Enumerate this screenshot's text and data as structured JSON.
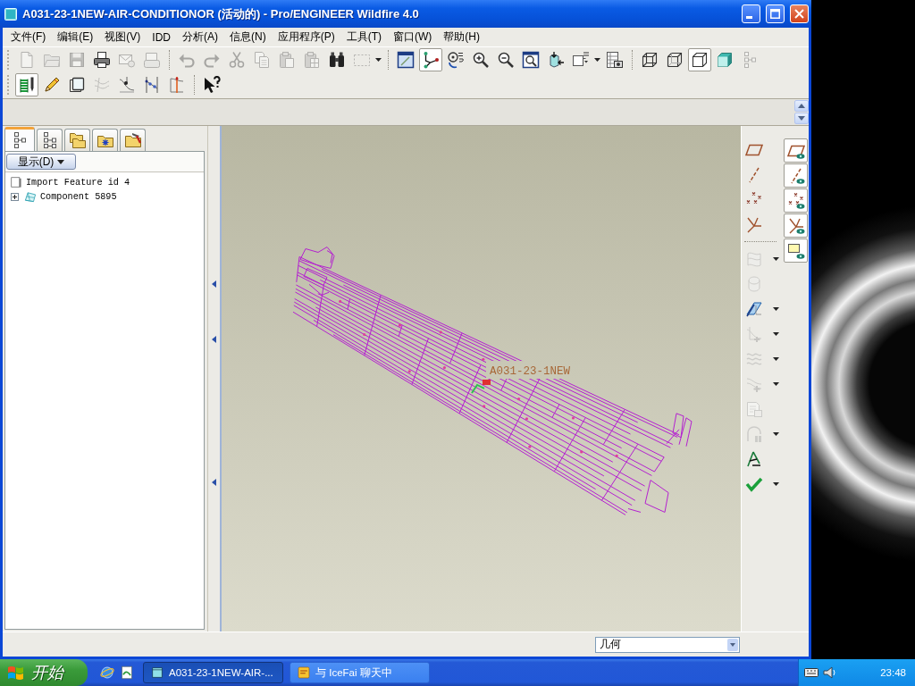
{
  "window": {
    "title": "A031-23-1NEW-AIR-CONDITIONOR (活动的) - Pro/ENGINEER Wildfire 4.0"
  },
  "menu_bar": [
    "文件(F)",
    "编辑(E)",
    "视图(V)",
    "IDD",
    "分析(A)",
    "信息(N)",
    "应用程序(P)",
    "工具(T)",
    "窗口(W)",
    "帮助(H)"
  ],
  "toolbar_rows": [
    {
      "groups": [
        {
          "buttons": [
            {
              "kind": "page",
              "disabled": true,
              "pressed": false,
              "menu": false
            },
            {
              "kind": "folder",
              "disabled": true,
              "pressed": false,
              "menu": false
            },
            {
              "kind": "floppy",
              "disabled": true,
              "pressed": false,
              "menu": false
            },
            {
              "kind": "printer",
              "disabled": false,
              "pressed": false,
              "menu": false
            },
            {
              "kind": "envelope",
              "disabled": true,
              "pressed": false,
              "menu": false
            },
            {
              "kind": "inbox",
              "disabled": true,
              "pressed": false,
              "menu": false
            }
          ]
        },
        {
          "buttons": [
            {
              "kind": "undo",
              "disabled": true,
              "pressed": false,
              "menu": false
            },
            {
              "kind": "redo",
              "disabled": true,
              "pressed": false,
              "menu": false
            },
            {
              "kind": "scissors",
              "disabled": true,
              "pressed": false,
              "menu": false
            },
            {
              "kind": "copy",
              "disabled": true,
              "pressed": false,
              "menu": false
            },
            {
              "kind": "paste",
              "disabled": true,
              "pressed": false,
              "menu": false
            },
            {
              "kind": "clipboard",
              "disabled": true,
              "pressed": false,
              "menu": false
            },
            {
              "kind": "binoculars",
              "disabled": false,
              "pressed": false,
              "menu": false
            },
            {
              "kind": "marquee",
              "disabled": true,
              "pressed": false,
              "menu": true
            }
          ]
        },
        {
          "buttons": [
            {
              "kind": "repaint",
              "disabled": false,
              "pressed": false,
              "menu": false
            },
            {
              "kind": "nodes",
              "disabled": false,
              "pressed": true,
              "menu": false
            },
            {
              "kind": "orient",
              "disabled": false,
              "pressed": false,
              "menu": false
            },
            {
              "kind": "zoomin",
              "disabled": false,
              "pressed": false,
              "menu": false
            },
            {
              "kind": "zoomout",
              "disabled": false,
              "pressed": false,
              "menu": false
            },
            {
              "kind": "zoomfit",
              "disabled": false,
              "pressed": false,
              "menu": false
            },
            {
              "kind": "reorient",
              "disabled": false,
              "pressed": false,
              "menu": false
            },
            {
              "kind": "views",
              "disabled": false,
              "pressed": false,
              "menu": true
            },
            {
              "kind": "layers",
              "disabled": false,
              "pressed": false,
              "menu": false
            }
          ]
        },
        {
          "buttons": [
            {
              "kind": "wireframe",
              "disabled": false,
              "pressed": false,
              "menu": false
            },
            {
              "kind": "hidden",
              "disabled": false,
              "pressed": false,
              "menu": false
            },
            {
              "kind": "nohidden",
              "disabled": false,
              "pressed": true,
              "menu": false
            },
            {
              "kind": "shaded",
              "disabled": false,
              "pressed": false,
              "menu": false
            },
            {
              "kind": "tree",
              "disabled": true,
              "pressed": false,
              "menu": false
            }
          ]
        }
      ]
    },
    {
      "groups": [
        {
          "buttons": [
            {
              "kind": "sketch",
              "disabled": false,
              "pressed": true,
              "menu": false
            },
            {
              "kind": "pencil",
              "disabled": false,
              "pressed": false,
              "menu": false
            },
            {
              "kind": "box",
              "disabled": false,
              "pressed": false,
              "menu": false
            },
            {
              "kind": "curves",
              "disabled": true,
              "pressed": false,
              "menu": false
            },
            {
              "kind": "probe",
              "disabled": false,
              "pressed": false,
              "menu": false
            },
            {
              "kind": "split",
              "disabled": false,
              "pressed": false,
              "menu": false
            },
            {
              "kind": "trim",
              "disabled": false,
              "pressed": false,
              "menu": false
            }
          ]
        },
        {
          "buttons": [
            {
              "kind": "help",
              "disabled": false,
              "pressed": false,
              "menu": false
            }
          ]
        }
      ]
    }
  ],
  "navigator": {
    "tabs": [
      {
        "kind": "tree",
        "selected": true
      },
      {
        "kind": "branches",
        "selected": false
      },
      {
        "kind": "folders",
        "selected": false
      },
      {
        "kind": "favorites",
        "selected": false
      },
      {
        "kind": "toolbox",
        "selected": false
      }
    ],
    "show_button": "显示(D)",
    "tree": [
      {
        "label": "Import Feature id 4",
        "kind": "feature",
        "has_children": false
      },
      {
        "label": "Component 5895",
        "kind": "component",
        "has_children": true,
        "expanded": false
      }
    ]
  },
  "viewport": {
    "model_label": "A031-23-1NEW"
  },
  "datum_toolbar": {
    "groups": [
      {
        "buttons": [
          {
            "kind": "plane",
            "disabled": false,
            "pressed": false,
            "menu": false
          },
          {
            "kind": "axis",
            "disabled": false,
            "pressed": false,
            "menu": false
          },
          {
            "kind": "points",
            "disabled": false,
            "pressed": false,
            "menu": false
          },
          {
            "kind": "csys",
            "disabled": false,
            "pressed": false,
            "menu": false
          }
        ]
      },
      {
        "buttons": [
          {
            "kind": "surface",
            "disabled": true,
            "pressed": false,
            "menu": true
          },
          {
            "kind": "blend",
            "disabled": true,
            "pressed": false,
            "menu": false
          },
          {
            "kind": "sweep",
            "disabled": false,
            "pressed": false,
            "menu": true
          },
          {
            "kind": "curvepoint",
            "disabled": true,
            "pressed": false,
            "menu": true
          },
          {
            "kind": "wave",
            "disabled": true,
            "pressed": false,
            "menu": true
          },
          {
            "kind": "curveplus",
            "disabled": true,
            "pressed": false,
            "menu": true
          },
          {
            "kind": "sheet",
            "disabled": true,
            "pressed": false,
            "menu": false
          },
          {
            "kind": "shell",
            "disabled": true,
            "pressed": false,
            "menu": true
          },
          {
            "kind": "compass",
            "disabled": false,
            "pressed": false,
            "menu": false
          },
          {
            "kind": "check",
            "disabled": false,
            "pressed": false,
            "menu": true
          }
        ]
      }
    ]
  },
  "display_toggles": [
    {
      "kind": "plane",
      "pressed": true
    },
    {
      "kind": "axis",
      "pressed": true
    },
    {
      "kind": "points",
      "pressed": true
    },
    {
      "kind": "csys",
      "pressed": true
    },
    {
      "kind": "note",
      "pressed": true
    }
  ],
  "status_bar": {
    "selection_filter": "几何"
  },
  "taskbar": {
    "start": "开始",
    "quick_launch": [
      {
        "kind": "globe"
      },
      {
        "kind": "document"
      }
    ],
    "tasks": [
      {
        "label": "A031-23-1NEW-AIR-...",
        "kind": "app",
        "selected": true
      },
      {
        "label": "与 IceFai 聊天中",
        "kind": "chat",
        "selected": false
      }
    ],
    "clock": "23:48"
  }
}
